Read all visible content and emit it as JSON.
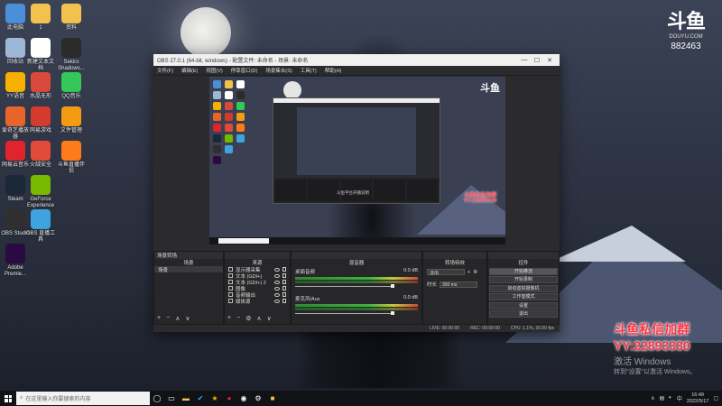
{
  "desktop": {
    "icons": [
      {
        "label": "此电脑",
        "icon": "computer-icon",
        "color": "#4a90d9"
      },
      {
        "label": "回收站",
        "icon": "recycle-bin-icon",
        "color": "#9db7d6"
      },
      {
        "label": "YY语音",
        "icon": "yy-icon",
        "color": "#f5b000"
      },
      {
        "label": "爱奇艺播放器",
        "icon": "iqiyi-icon",
        "color": "#e8652a"
      },
      {
        "label": "网易云音乐",
        "icon": "netease-music-icon",
        "color": "#e0242d"
      },
      {
        "label": "Steam",
        "icon": "steam-icon",
        "color": "#1b2838"
      },
      {
        "label": "OBS Studio",
        "icon": "obs-icon",
        "color": "#302e31"
      },
      {
        "label": "Adobe Premie...",
        "icon": "premiere-icon",
        "color": "#2a0a40"
      },
      {
        "label": "1",
        "icon": "folder-icon",
        "color": "#f2c14e"
      },
      {
        "label": "新建文本文档",
        "icon": "text-file-icon",
        "color": "#ffffff"
      },
      {
        "label": "水晶无形",
        "icon": "app-icon",
        "color": "#d94a3c"
      },
      {
        "label": "网易游戏",
        "icon": "game-icon",
        "color": "#d33b2f"
      },
      {
        "label": "火绒安全",
        "icon": "security-icon",
        "color": "#e24a3a"
      },
      {
        "label": "GeForce Experience",
        "icon": "geforce-icon",
        "color": "#76b900"
      },
      {
        "label": "OBS 直播工具",
        "icon": "live-tool-icon",
        "color": "#3fa3e0"
      },
      {
        "label": "资料",
        "icon": "folder-icon",
        "color": "#f2c14e"
      },
      {
        "label": "Sekiro Shadows...",
        "icon": "sekiro-icon",
        "color": "#2b2b2b"
      },
      {
        "label": "QQ音乐",
        "icon": "qq-music-icon",
        "color": "#34c759"
      },
      {
        "label": "文件管理",
        "icon": "folder-manager-icon",
        "color": "#f39c12"
      },
      {
        "label": "斗鱼直播伴侣",
        "icon": "douyu-icon",
        "color": "#ff7a1a"
      }
    ]
  },
  "watermark": {
    "logo": "斗鱼",
    "site": "DOUYU.COM",
    "room": "882463"
  },
  "promo": {
    "line1": "斗鱼私信加群",
    "line2": "YY:22893330"
  },
  "activation": {
    "line1": "激活 Windows",
    "line2": "转到\"设置\"以激活 Windows。"
  },
  "obs": {
    "title": "OBS 27.0.1 (64-bit, windows) - 配置文件: 未命名 - 场景: 未命名",
    "menu": [
      "文件(F)",
      "编辑(E)",
      "视图(V)",
      "停靠窗口(D)",
      "场景集合(S)",
      "工具(T)",
      "帮助(H)"
    ],
    "preview": {
      "nested_text": "斗鱼平台开播说明",
      "promo1": "斗鱼私信加群",
      "promo2": "YY:22893330",
      "logo": "斗鱼"
    },
    "docks": {
      "scenes": {
        "title": "场景",
        "items": [
          "场景"
        ]
      },
      "sources": {
        "title": "来源",
        "items": [
          "显示器采集",
          "文本 (GDI+)",
          "文本 (GDI+) 2",
          "图像",
          "音频输出",
          "媒体源"
        ]
      },
      "mixer": {
        "title": "混音器",
        "channels": [
          {
            "name": "桌面音频",
            "db": "0.0 dB"
          },
          {
            "name": "麦克风/Aux",
            "db": "0.0 dB"
          }
        ]
      },
      "transitions": {
        "title": "转场特效",
        "type": "淡出",
        "duration_label": "时长",
        "duration": "300 ms"
      },
      "controls": {
        "title": "控件",
        "buttons": [
          "开始推流",
          "开始录制",
          "启动虚拟摄像机",
          "工作室模式",
          "设置",
          "退出"
        ]
      }
    },
    "status": [
      "LIVE: 00:00:00",
      "REC: 00:00:00",
      "CPU: 1.1%, 30.00 fps"
    ]
  },
  "taskbar": {
    "search_placeholder": "在这里输入你要搜索的内容",
    "time": "16:49",
    "date": "2022/5/17"
  }
}
